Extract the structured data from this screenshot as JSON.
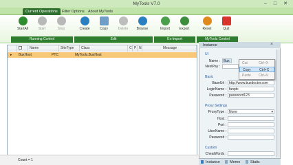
{
  "window": {
    "title": "MyTools V7.0",
    "minimize": "–",
    "maximize": "□",
    "close": "✕"
  },
  "tabs": [
    {
      "label": "Current Operations",
      "active": true
    },
    {
      "label": "Filter Options",
      "active": false
    },
    {
      "label": "About MyTools",
      "active": false
    }
  ],
  "ribbon": {
    "buttons": [
      {
        "label": "StartAll",
        "icon": "play-icon",
        "color": "#2e8b2e",
        "enabled": true
      },
      {
        "label": "Start",
        "icon": "play-icon",
        "color": "#a8a8a8",
        "enabled": false
      },
      {
        "label": "Stop",
        "icon": "stop-icon",
        "color": "#a8a8a8",
        "enabled": false
      },
      {
        "label": "Create",
        "icon": "create-icon",
        "color": "#2a7fc1",
        "enabled": true
      },
      {
        "label": "Copy",
        "icon": "copy-icon",
        "color": "#6f9fc7",
        "enabled": true
      },
      {
        "label": "Delete",
        "icon": "delete-icon",
        "color": "#a8a8a8",
        "enabled": false
      },
      {
        "label": "Browse",
        "icon": "browse-icon",
        "color": "#2a7fc1",
        "enabled": true
      },
      {
        "label": "Import",
        "icon": "import-icon",
        "color": "#4aa04a",
        "enabled": true
      },
      {
        "label": "Export",
        "icon": "export-icon",
        "color": "#3c8d3c",
        "enabled": true
      },
      {
        "label": "Reset",
        "icon": "reset-icon",
        "color": "#e08a1e",
        "enabled": true
      },
      {
        "label": "Quit",
        "icon": "quit-icon",
        "color": "#d9342b",
        "enabled": true
      }
    ],
    "groups": [
      "Running Control",
      "Edit",
      "Ex-Import",
      "MyTools Control"
    ]
  },
  "grid": {
    "columns": [
      "Name",
      "SiteType",
      "Class",
      "C",
      "P",
      "N",
      "Message"
    ],
    "rows": [
      {
        "marker": "▸",
        "name": "BuxHost",
        "sitetype": "PTC",
        "class": "MyTools.BuxHost"
      }
    ]
  },
  "status": {
    "count": "Count = 1"
  },
  "panel": {
    "title": "Instance",
    "sections": {
      "ui": "UI",
      "basic": "Basic",
      "proxy": "Proxy Settings",
      "custom": "Custom"
    },
    "fields": {
      "name_label": "Name :",
      "name_value": "Bux",
      "nextpay_label": "NextPay :",
      "nextpay_value": "",
      "baseurl_label": "BaseUrl :",
      "baseurl_value": "http://www.buxdoctor.com",
      "loginname_label": "LoginName :",
      "loginname_value": "fanptc",
      "password_label": "Password :",
      "password_value": "password123",
      "proxytype_label": "ProxyType :",
      "proxytype_value": "None",
      "host_label": "Host :",
      "port_label": "Port :",
      "username_label": "UserName :",
      "proxypassword_label": "Password :",
      "cheatwords_label": "CheatWords :"
    },
    "bottom_tabs": [
      "Instance",
      "Memo",
      "Static"
    ]
  },
  "context_menu": [
    {
      "label": "Cut",
      "shortcut": "Ctrl+X",
      "selected": false
    },
    {
      "label": "Copy",
      "shortcut": "Ctrl+C",
      "selected": true
    },
    {
      "label": "Paste",
      "shortcut": "Ctrl+V",
      "selected": false
    }
  ]
}
